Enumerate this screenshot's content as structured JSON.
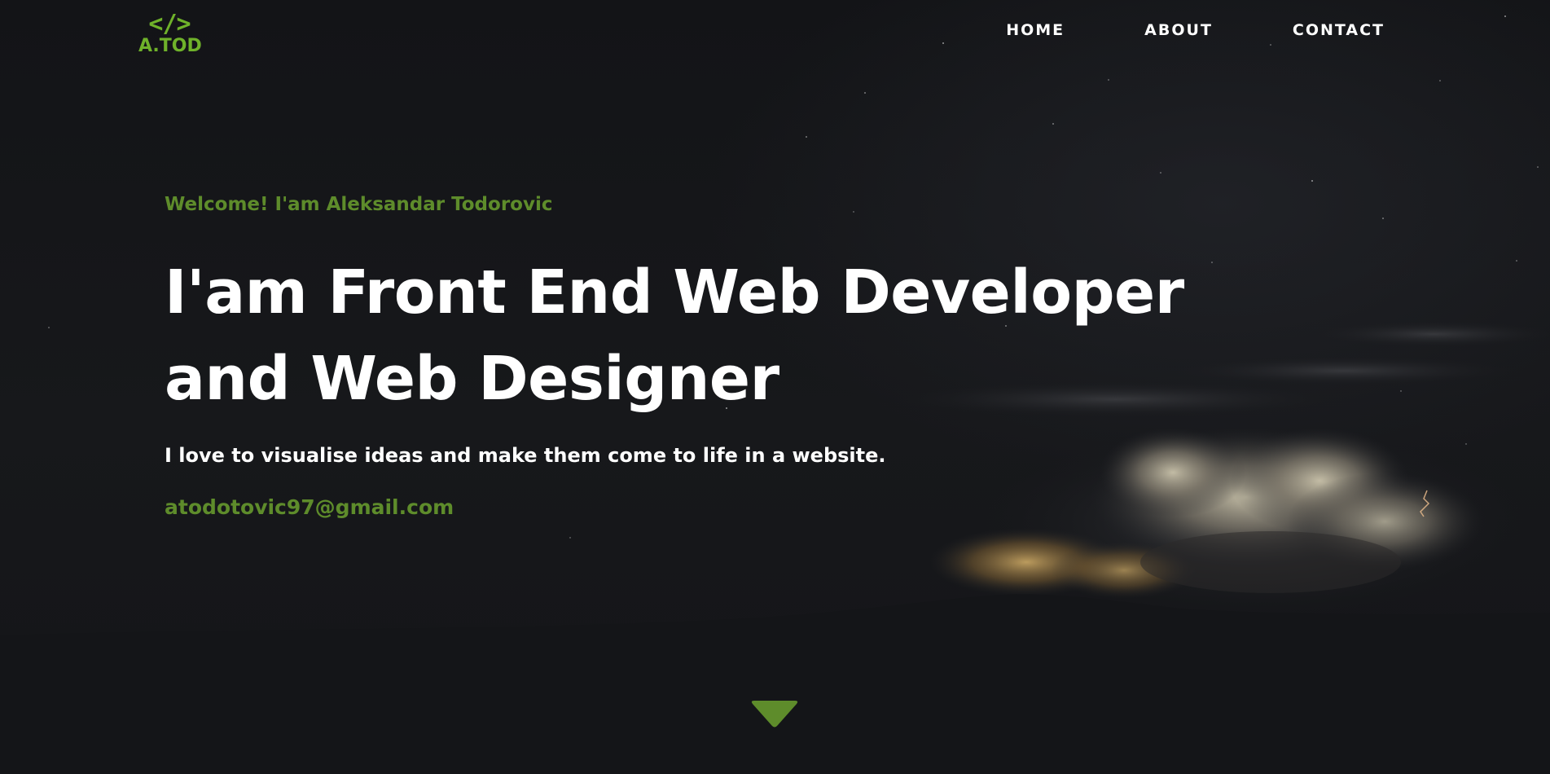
{
  "header": {
    "logo_mark": "</>",
    "logo_text": "A.TOD",
    "nav": [
      {
        "label": "HOME"
      },
      {
        "label": "ABOUT"
      },
      {
        "label": "CONTACT"
      }
    ]
  },
  "hero": {
    "welcome": "Welcome! I'am Aleksandar Todorovic",
    "headline": "I'am Front End Web Developer and Web Designer",
    "tagline": "I love to visualise ideas and make them come to life in a website.",
    "email": "atodotovic97@gmail.com",
    "scroll_icon": "triangle-down-icon"
  },
  "colors": {
    "background": "#141518",
    "accent": "#6fb22a",
    "accent_dark": "#5e8c2b",
    "text": "#ffffff"
  }
}
